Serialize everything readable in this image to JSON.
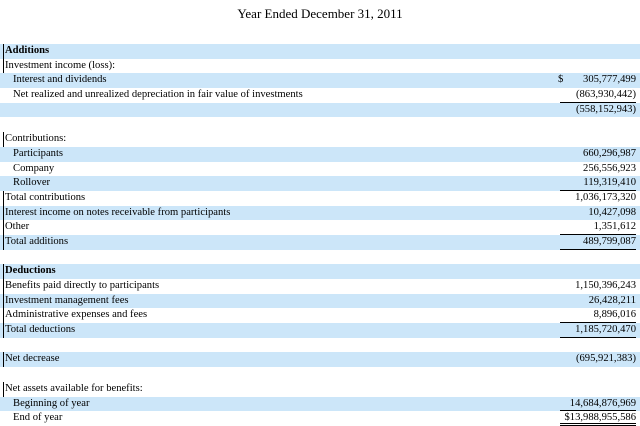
{
  "title": "Year Ended December 31, 2011",
  "rows": [
    {
      "label": "Additions",
      "value": "",
      "bold": true,
      "indent": 0,
      "shade": true
    },
    {
      "label": "Investment income (loss):",
      "value": "",
      "indent": 0,
      "shade": false
    },
    {
      "label": "Interest and dividends",
      "value": "305,777,499",
      "dollar": "$",
      "indent": 1,
      "shade": true
    },
    {
      "label": "Net realized and unrealized depreciation in fair value of investments",
      "value": "(863,930,442)",
      "indent": 1,
      "shade": false,
      "rule": "ul"
    },
    {
      "label": "",
      "value": "(558,152,943)",
      "indent": 1,
      "shade": true
    },
    {
      "spacer": true
    },
    {
      "label": "Contributions:",
      "value": "",
      "indent": 0,
      "shade": false
    },
    {
      "label": "Participants",
      "value": "660,296,987",
      "indent": 1,
      "shade": true
    },
    {
      "label": "Company",
      "value": "256,556,923",
      "indent": 1,
      "shade": false
    },
    {
      "label": "Rollover",
      "value": "119,319,410",
      "indent": 1,
      "shade": true,
      "rule": "ul"
    },
    {
      "label": "Total contributions",
      "value": "1,036,173,320",
      "indent": 0,
      "shade": false
    },
    {
      "label": "Interest income on notes receivable from participants",
      "value": "10,427,098",
      "indent": 0,
      "shade": true
    },
    {
      "label": "Other",
      "value": "1,351,612",
      "indent": 0,
      "shade": false,
      "rule": "ul"
    },
    {
      "label": "Total additions",
      "value": "489,799,087",
      "indent": 0,
      "shade": true,
      "rule": "ul"
    },
    {
      "spacer": true
    },
    {
      "label": "Deductions",
      "value": "",
      "bold": true,
      "indent": 0,
      "shade": true
    },
    {
      "label": "Benefits paid directly to participants",
      "value": "1,150,396,243",
      "indent": 0,
      "shade": false
    },
    {
      "label": "Investment management fees",
      "value": "26,428,211",
      "indent": 0,
      "shade": true
    },
    {
      "label": "Administrative expenses and fees",
      "value": "8,896,016",
      "indent": 0,
      "shade": false,
      "rule": "ul"
    },
    {
      "label": "Total deductions",
      "value": "1,185,720,470",
      "indent": 0,
      "shade": true,
      "rule": "ul"
    },
    {
      "spacer": true
    },
    {
      "label": "Net decrease",
      "value": "(695,921,383)",
      "indent": 0,
      "shade": true
    },
    {
      "spacer": true
    },
    {
      "label": "Net assets available for benefits:",
      "value": "",
      "indent": 0,
      "shade": false
    },
    {
      "label": "Beginning of year",
      "value": "14,684,876,969",
      "indent": 1,
      "shade": true,
      "rule": "ul"
    },
    {
      "label": "End of year",
      "value": "$13,988,955,586",
      "indent": 1,
      "shade": false,
      "rule": "dul"
    }
  ]
}
